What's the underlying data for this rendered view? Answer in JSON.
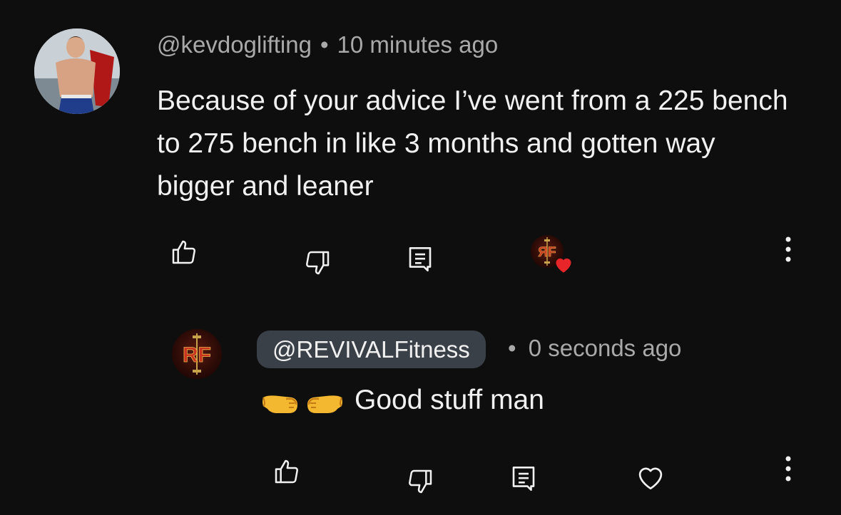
{
  "comment": {
    "author": "@kevdoglifting",
    "separator": "•",
    "time": "10 minutes ago",
    "text": "Because of your advice I’ve went from a 225 bench to 275 bench in like 3 months and gotten way bigger and leaner",
    "actions": {
      "like_icon": "thumbs-up-icon",
      "dislike_icon": "thumbs-down-icon",
      "reply_icon": "reply-comment-icon",
      "creator_heart_icon": "creator-heart-badge-icon",
      "more_icon": "more-vertical-icon"
    }
  },
  "reply": {
    "author": "@REVIVALFitness",
    "separator": "•",
    "time": "0 seconds ago",
    "emoji": "🤜🤛",
    "text": "Good stuff man",
    "avatar_initials": "RF",
    "actions": {
      "like_icon": "thumbs-up-icon",
      "dislike_icon": "thumbs-down-icon",
      "reply_icon": "reply-comment-icon",
      "heart_icon": "heart-outline-icon",
      "more_icon": "more-vertical-icon"
    }
  },
  "colors": {
    "background": "#0e0e0e",
    "text": "#f1f1f1",
    "muted": "#a9a9a9",
    "chip": "#3a4048",
    "heart": "#e8262a",
    "brand_red": "#c8321f",
    "brand_gold": "#c8a24a"
  }
}
